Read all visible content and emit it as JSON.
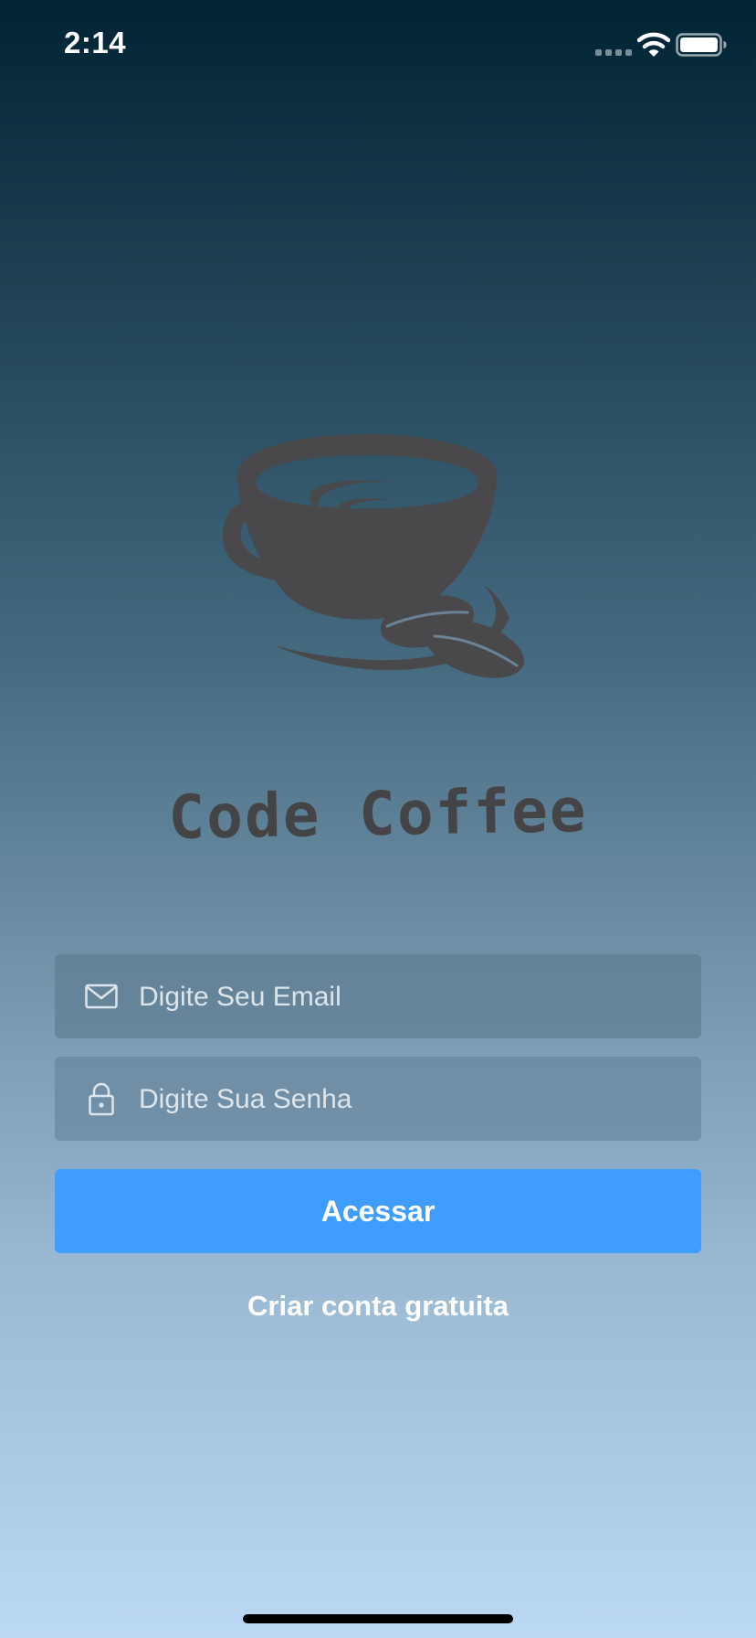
{
  "status_bar": {
    "time": "2:14",
    "icons": [
      "signal-icon",
      "wifi-icon",
      "battery-icon"
    ]
  },
  "logo": {
    "icon": "coffee-cup-icon",
    "title": "Code Coffee"
  },
  "login_form": {
    "email": {
      "icon": "envelope-icon",
      "placeholder": "Digite Seu Email",
      "value": ""
    },
    "password": {
      "icon": "lock-icon",
      "placeholder": "Digite Sua Senha",
      "value": ""
    },
    "submit_label": "Acessar",
    "signup_label": "Criar conta gratuita"
  },
  "colors": {
    "primary_button": "#3f9dff",
    "logo_gray": "#49494b",
    "background_top": "#002434",
    "background_bottom": "#bcd9f3"
  }
}
